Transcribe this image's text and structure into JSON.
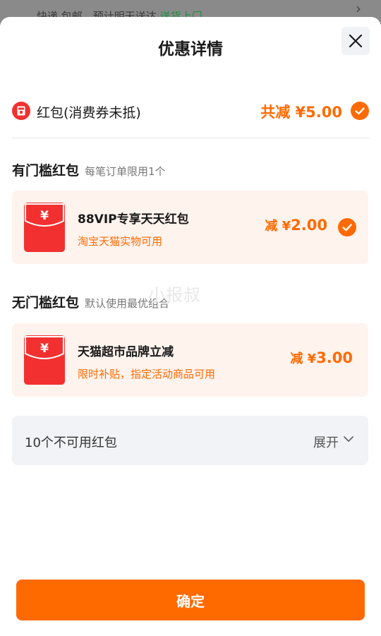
{
  "background": {
    "text_prefix": "快递 包邮，预计明天送达",
    "text_green": "送货上门"
  },
  "sheet": {
    "title": "优惠详情",
    "close_icon": "close-icon"
  },
  "summary": {
    "label": "红包(消费券未抵)",
    "amount": "共减 ¥5.00",
    "checked": true
  },
  "threshold_section": {
    "title": "有门槛红包",
    "subtitle": "每笔订单限用1个",
    "card": {
      "name": "88VIP专享天天红包",
      "desc": "淘宝天猫实物可用",
      "amount_prefix": "减 ¥",
      "amount": "2.00",
      "checked": true
    }
  },
  "no_threshold_section": {
    "title": "无门槛红包",
    "subtitle": "默认使用最优组合",
    "card": {
      "name": "天猫超市品牌立减",
      "desc": "限时补贴，指定活动商品可用",
      "amount_prefix": "减 ¥",
      "amount": "3.00",
      "checked": false
    }
  },
  "unavailable": {
    "label": "10个不可用红包",
    "expand": "展开"
  },
  "watermark": "小报叔",
  "confirm_label": "确定",
  "colors": {
    "accent": "#ff6a00",
    "card_bg": "#fff3ee",
    "envelope_red": "#f23030"
  }
}
